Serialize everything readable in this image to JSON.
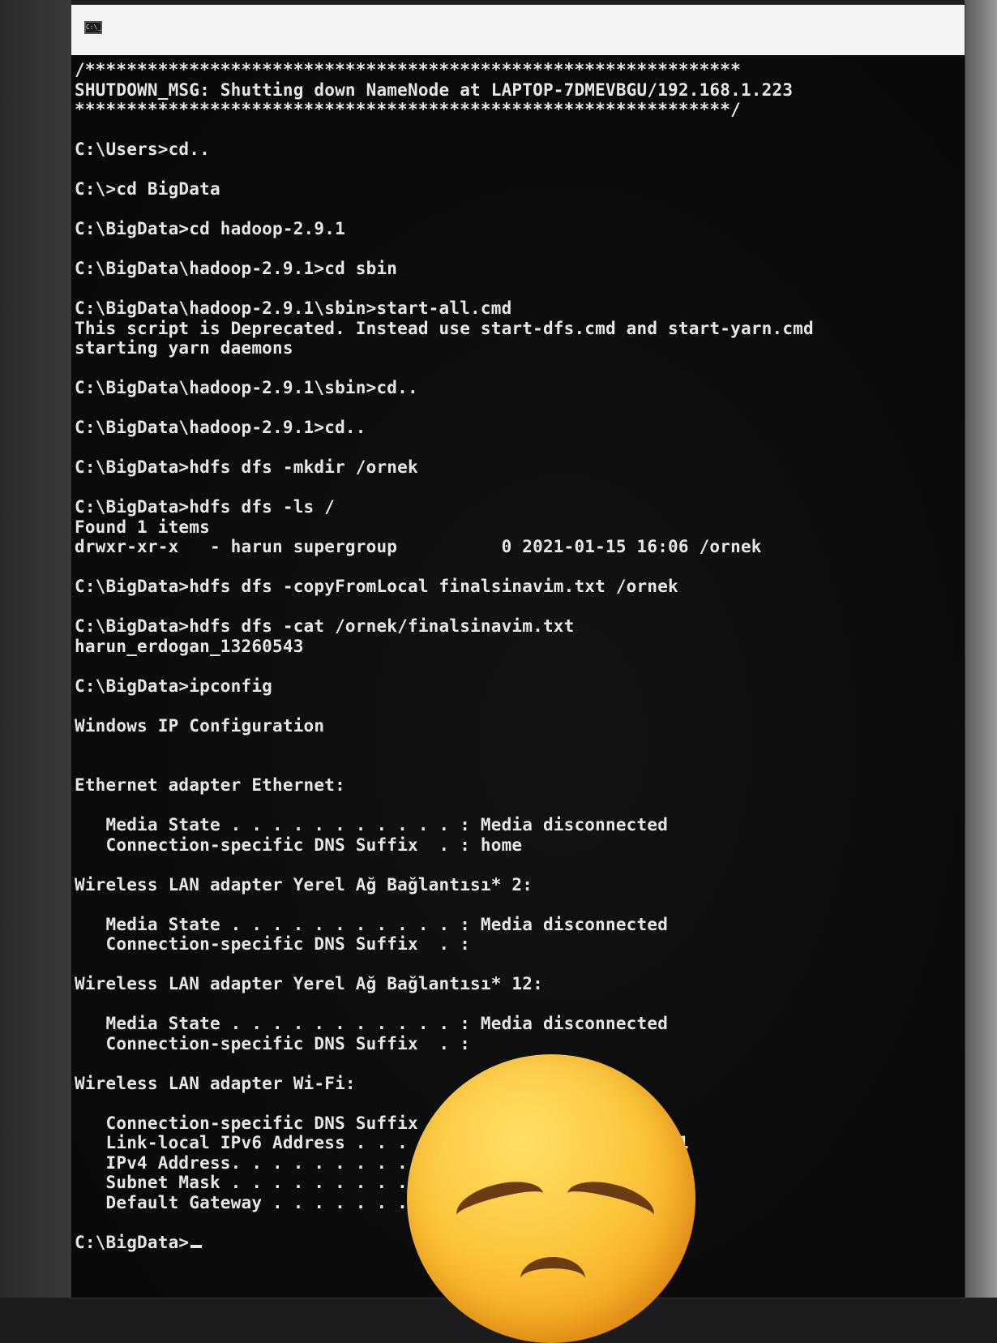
{
  "window": {
    "icon": "cmd-icon",
    "icon_text": "C:\\_"
  },
  "console": {
    "lines": [
      "/***************************************************************",
      "SHUTDOWN_MSG: Shutting down NameNode at LAPTOP-7DMEVBGU/192.168.1.223",
      "***************************************************************/",
      "",
      "C:\\Users>cd..",
      "",
      "C:\\>cd BigData",
      "",
      "C:\\BigData>cd hadoop-2.9.1",
      "",
      "C:\\BigData\\hadoop-2.9.1>cd sbin",
      "",
      "C:\\BigData\\hadoop-2.9.1\\sbin>start-all.cmd",
      "This script is Deprecated. Instead use start-dfs.cmd and start-yarn.cmd",
      "starting yarn daemons",
      "",
      "C:\\BigData\\hadoop-2.9.1\\sbin>cd..",
      "",
      "C:\\BigData\\hadoop-2.9.1>cd..",
      "",
      "C:\\BigData>hdfs dfs -mkdir /ornek",
      "",
      "C:\\BigData>hdfs dfs -ls /",
      "Found 1 items",
      "drwxr-xr-x   - harun supergroup          0 2021-01-15 16:06 /ornek",
      "",
      "C:\\BigData>hdfs dfs -copyFromLocal finalsinavim.txt /ornek",
      "",
      "C:\\BigData>hdfs dfs -cat /ornek/finalsinavim.txt",
      "harun_erdogan_13260543",
      "",
      "C:\\BigData>ipconfig",
      "",
      "Windows IP Configuration",
      "",
      "",
      "Ethernet adapter Ethernet:",
      "",
      "   Media State . . . . . . . . . . . : Media disconnected",
      "   Connection-specific DNS Suffix  . : home",
      "",
      "Wireless LAN adapter Yerel Ağ Bağlantısı* 2:",
      "",
      "   Media State . . . . . . . . . . . : Media disconnected",
      "   Connection-specific DNS Suffix  . :",
      "",
      "Wireless LAN adapter Yerel Ağ Bağlantısı* 12:",
      "",
      "   Media State . . . . . . . . . . . : Media disconnected",
      "   Connection-specific DNS Suffix  . :",
      "",
      "Wireless LAN adapter Wi-Fi:",
      "",
      "   Connection-specific DNS Suffix  . :",
      "   Link-local IPv6 Address . . . . . :                   11",
      "   IPv4 Address. . . . . . . . . . . :",
      "   Subnet Mask . . . . . . . . . . . :",
      "   Default Gateway . . . . . . . . . :",
      "",
      "C:\\BigData>"
    ]
  },
  "overlay": {
    "emoji": "disappointed-face-emoji",
    "color": "#fcc43a"
  }
}
